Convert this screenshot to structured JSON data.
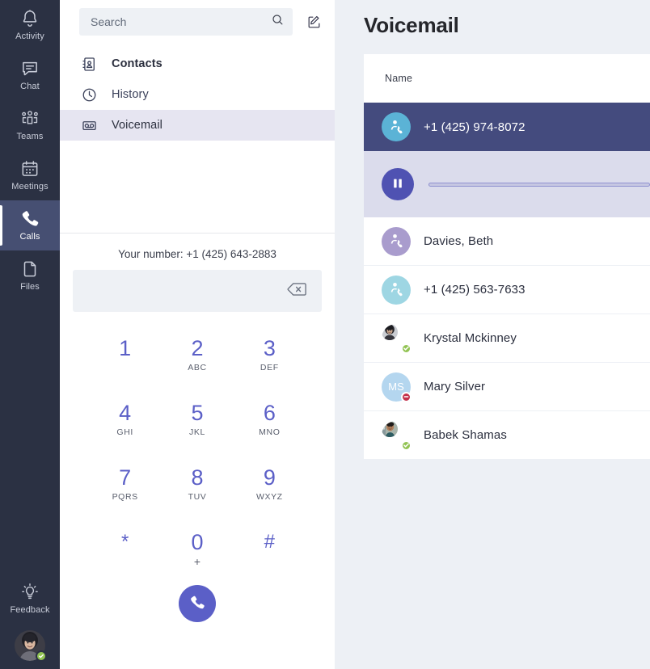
{
  "rail": {
    "items": [
      {
        "label": "Activity",
        "icon": "bell-icon",
        "active": false
      },
      {
        "label": "Chat",
        "icon": "chat-icon",
        "active": false
      },
      {
        "label": "Teams",
        "icon": "teams-icon",
        "active": false
      },
      {
        "label": "Meetings",
        "icon": "calendar-icon",
        "active": false
      },
      {
        "label": "Calls",
        "icon": "phone-icon",
        "active": true
      },
      {
        "label": "Files",
        "icon": "file-icon",
        "active": false
      }
    ],
    "feedback": {
      "label": "Feedback",
      "icon": "lightbulb-icon"
    },
    "profile": {
      "presence": "available"
    }
  },
  "search": {
    "placeholder": "Search",
    "icon": "search-icon",
    "compose_icon": "compose-icon"
  },
  "nav": {
    "items": [
      {
        "label": "Contacts",
        "icon": "contacts-icon",
        "selected": false
      },
      {
        "label": "History",
        "icon": "clock-icon",
        "selected": false
      },
      {
        "label": "Voicemail",
        "icon": "voicemail-icon",
        "selected": true
      }
    ]
  },
  "dialer": {
    "your_number_label": "Your number: +1 (425) 643-2883",
    "input_value": "",
    "backspace_icon": "backspace-icon",
    "call_icon": "phone-icon",
    "keys": [
      {
        "digit": "1",
        "letters": ""
      },
      {
        "digit": "2",
        "letters": "ABC"
      },
      {
        "digit": "3",
        "letters": "DEF"
      },
      {
        "digit": "4",
        "letters": "GHI"
      },
      {
        "digit": "5",
        "letters": "JKL"
      },
      {
        "digit": "6",
        "letters": "MNO"
      },
      {
        "digit": "7",
        "letters": "PQRS"
      },
      {
        "digit": "8",
        "letters": "TUV"
      },
      {
        "digit": "9",
        "letters": "WXYZ"
      },
      {
        "digit": "*",
        "letters": ""
      },
      {
        "digit": "0",
        "letters": "+"
      },
      {
        "digit": "#",
        "letters": ""
      }
    ]
  },
  "main": {
    "title": "Voicemail",
    "columns": {
      "name": "Name"
    },
    "rows": [
      {
        "name": "+1 (425) 974-8072",
        "selected": true,
        "avatar": {
          "type": "glyph",
          "icon": "person-call-icon",
          "color": "#5bb3d6"
        },
        "presence": ""
      },
      {
        "name": "Davies, Beth",
        "selected": false,
        "avatar": {
          "type": "glyph",
          "icon": "person-call-icon",
          "color": "#a99ccd"
        },
        "presence": ""
      },
      {
        "name": "+1 (425) 563-7633",
        "selected": false,
        "avatar": {
          "type": "glyph",
          "icon": "person-call-icon",
          "color": "#9ed6e3"
        },
        "presence": ""
      },
      {
        "name": "Krystal Mckinney",
        "selected": false,
        "avatar": {
          "type": "photo",
          "variant": "krystal",
          "color": "#6b6b72"
        },
        "presence": "available"
      },
      {
        "name": "Mary Silver",
        "selected": false,
        "avatar": {
          "type": "initials",
          "initials": "MS",
          "color": "#b4d6ef"
        },
        "presence": "busy"
      },
      {
        "name": "Babek Shamas",
        "selected": false,
        "avatar": {
          "type": "photo",
          "variant": "babek",
          "color": "#7d8a80"
        },
        "presence": "available"
      }
    ],
    "player": {
      "state": "playing",
      "pause_icon": "pause-icon",
      "progress_percent": 0
    }
  },
  "colors": {
    "rail_bg": "#2b3143",
    "rail_active": "#464f72",
    "accent": "#5b5fc7",
    "selected_row": "#444b7e",
    "player_bg": "#dbdcec",
    "nav_selected": "#e6e5f1",
    "page_bg": "#edf0f5",
    "available": "#92c353",
    "busy": "#c4314b"
  }
}
